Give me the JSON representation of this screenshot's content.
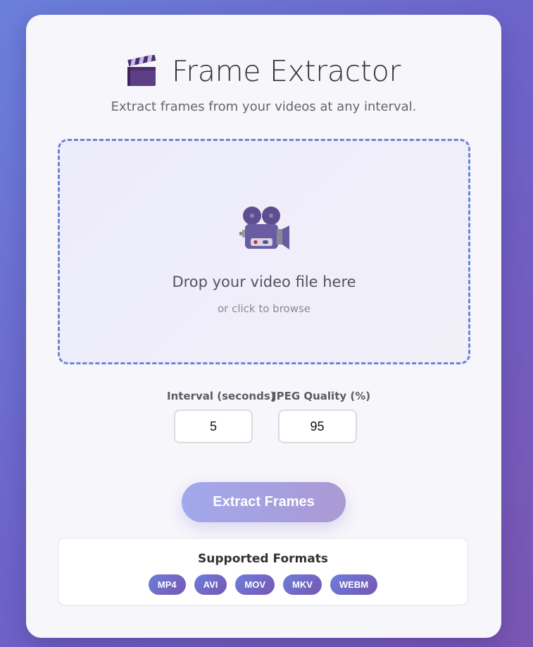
{
  "header": {
    "icon": "clapperboard-icon",
    "title": "Frame Extractor",
    "subtitle": "Extract frames from your videos at any interval."
  },
  "dropzone": {
    "icon": "movie-camera-icon",
    "main_text": "Drop your video file here",
    "sub_text": "or click to browse"
  },
  "settings": {
    "interval": {
      "label": "Interval (seconds)",
      "value": "5"
    },
    "quality": {
      "label": "JPEG Quality (%)",
      "value": "95"
    }
  },
  "actions": {
    "extract_label": "Extract Frames"
  },
  "formats": {
    "title": "Supported Formats",
    "items": [
      "MP4",
      "AVI",
      "MOV",
      "MKV",
      "WEBM"
    ]
  },
  "colors": {
    "background_gradient_start": "#6a7fdb",
    "background_gradient_end": "#7a55b2",
    "dropzone_border": "#6b84d8",
    "button_gradient_start": "#a1a8ec",
    "button_gradient_end": "#ab99d4"
  }
}
